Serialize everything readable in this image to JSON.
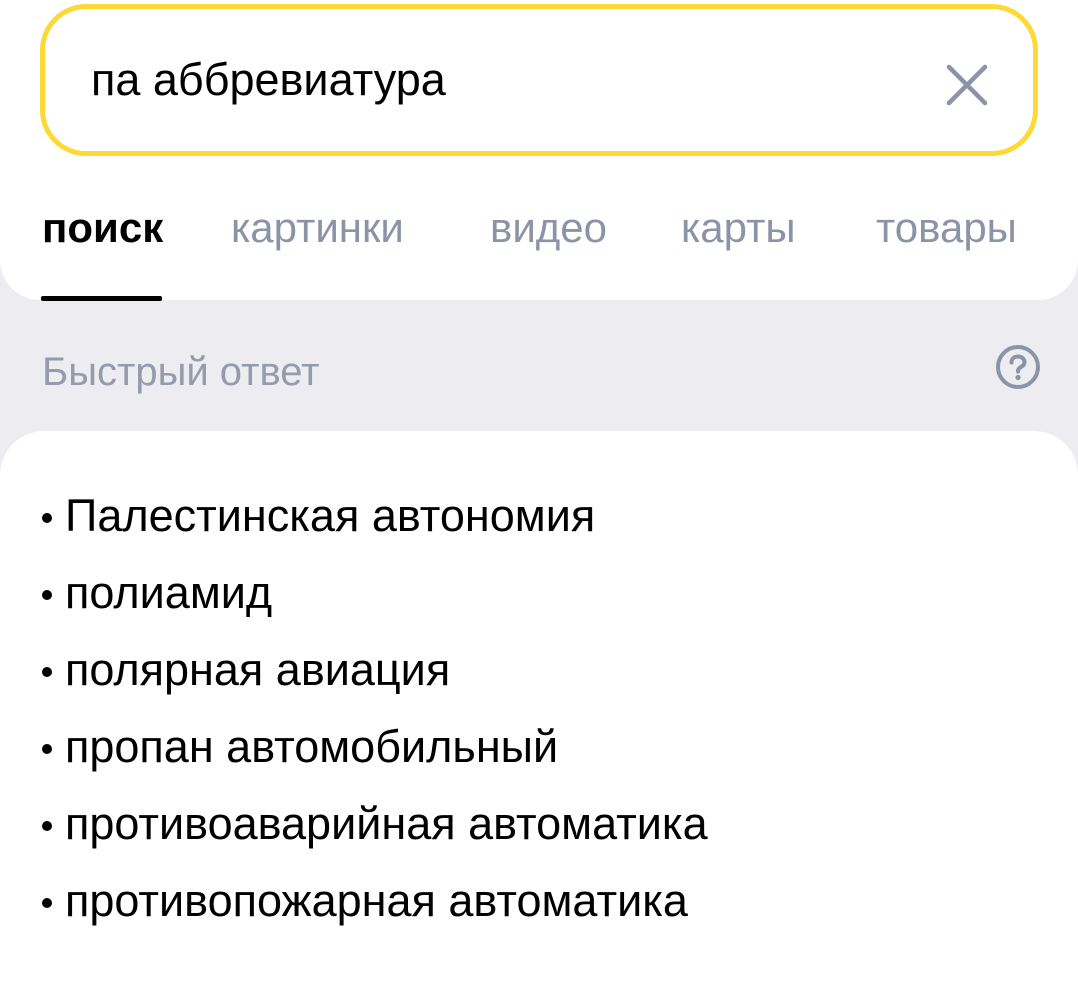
{
  "search": {
    "query": "па аббревиатура",
    "clear_icon": "close-icon"
  },
  "tabs": [
    {
      "label": "поиск",
      "active": true
    },
    {
      "label": "картинки",
      "active": false
    },
    {
      "label": "видео",
      "active": false
    },
    {
      "label": "карты",
      "active": false
    },
    {
      "label": "товары",
      "active": false
    }
  ],
  "quick_answer": {
    "header": "Быстрый ответ",
    "help_icon": "question-circle-icon",
    "items": [
      "Палестинская автономия",
      "полиамид",
      "полярная авиация",
      "пропан автомобильный",
      "противоаварийная автоматика",
      "противопожарная автоматика"
    ]
  },
  "colors": {
    "search_border": "#fcd934",
    "page_background": "#ececf1",
    "inactive_tab": "#8b93a6",
    "header_text": "#959bab"
  }
}
